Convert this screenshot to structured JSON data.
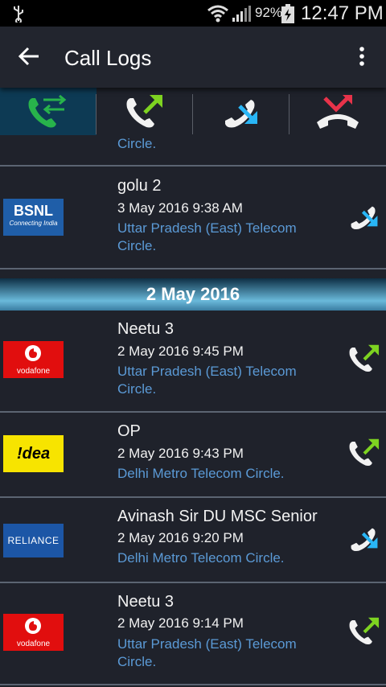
{
  "status_bar": {
    "battery": "92%",
    "time": "12:47 PM"
  },
  "app_bar": {
    "title": "Call Logs"
  },
  "tabs": [
    {
      "name": "all-calls",
      "active": true
    },
    {
      "name": "outgoing-calls",
      "active": false
    },
    {
      "name": "incoming-calls",
      "active": false
    },
    {
      "name": "missed-calls",
      "active": false
    }
  ],
  "partial_row": {
    "circle_tail": "Circle."
  },
  "entries_before": [
    {
      "name": "golu 2",
      "datetime": "3 May 2016 9:38 AM",
      "circle": "Uttar Pradesh (East) Telecom Circle.",
      "operator": "BSNL",
      "operator_sub": "Connecting India",
      "call_type": "incoming"
    }
  ],
  "date_header": "2 May 2016",
  "entries": [
    {
      "name": "Neetu 3",
      "datetime": "2 May 2016 9:45 PM",
      "circle": "Uttar Pradesh (East) Telecom Circle.",
      "operator": "vodafone",
      "call_type": "outgoing"
    },
    {
      "name": "OP",
      "datetime": "2 May 2016 9:43 PM",
      "circle": "Delhi Metro Telecom Circle.",
      "operator": "!dea",
      "call_type": "outgoing"
    },
    {
      "name": "Avinash Sir DU MSC Senior",
      "datetime": "2 May 2016 9:20 PM",
      "circle": "Delhi Metro Telecom Circle.",
      "operator": "RELIANCE",
      "call_type": "incoming"
    },
    {
      "name": "Neetu 3",
      "datetime": "2 May 2016 9:14 PM",
      "circle": "Uttar Pradesh (East) Telecom Circle.",
      "operator": "vodafone",
      "call_type": "outgoing"
    }
  ],
  "colors": {
    "background": "#1f222b",
    "circle_text": "#5b9ad6",
    "active_tab": "#0d3a54",
    "outgoing_arrow": "#7ed321",
    "incoming_arrow": "#29b6f6",
    "missed_arrow": "#e8334a"
  }
}
